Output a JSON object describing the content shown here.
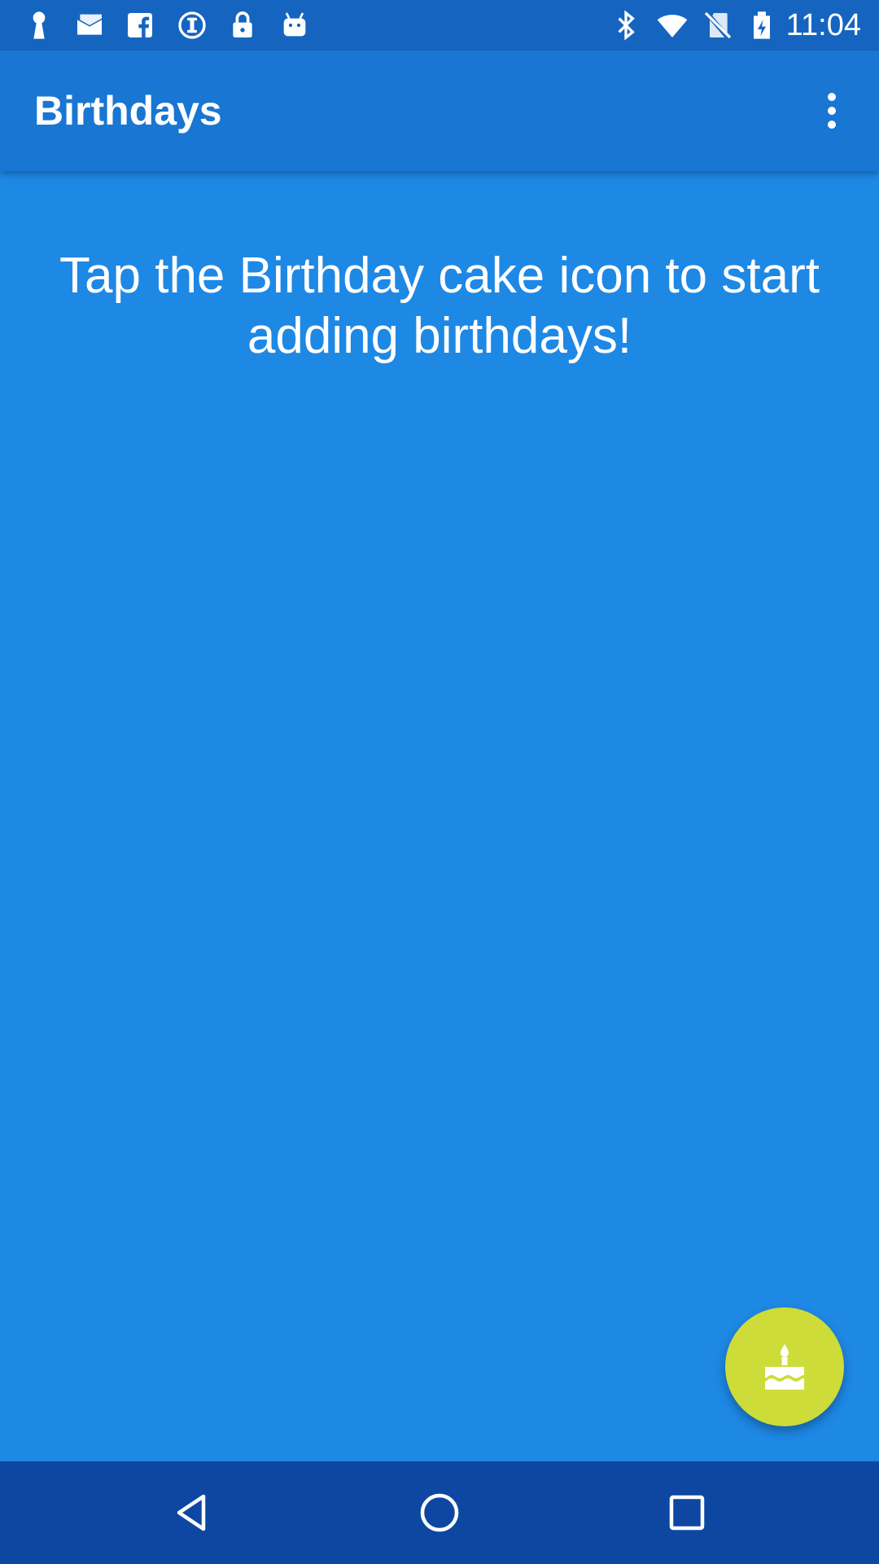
{
  "status_bar": {
    "time": "11:04",
    "left_icons": [
      "keyhole-icon",
      "mail-icon",
      "facebook-icon",
      "info-circle-icon",
      "lock-icon",
      "android-icon"
    ],
    "right_icons": [
      "bluetooth-icon",
      "wifi-icon",
      "no-sim-icon",
      "battery-icon"
    ]
  },
  "app_bar": {
    "title": "Birthdays",
    "overflow_icon": "more-vert-icon"
  },
  "content": {
    "empty_message": "Tap the Birthday cake icon to start adding birthdays!"
  },
  "fab": {
    "icon": "cake-icon",
    "color": "#CDDC39"
  },
  "nav_bar": {
    "icons": [
      "back-icon",
      "home-icon",
      "recents-icon"
    ]
  },
  "colors": {
    "status_bar": "#1565C0",
    "app_bar": "#1976D2",
    "background": "#1E88E5",
    "nav_bar": "#0D47A1"
  }
}
